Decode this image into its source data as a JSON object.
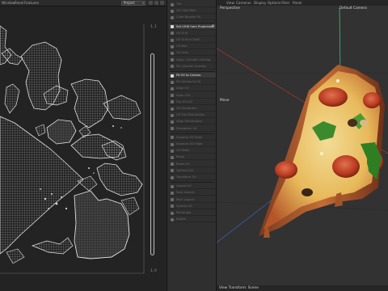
{
  "menubar": {
    "items": [
      "Window",
      "Panel",
      "Features"
    ],
    "project_select": "Project"
  },
  "uv_editor": {
    "corner_top_right": "1, 1",
    "corner_bottom_right": "1, 0"
  },
  "tools": {
    "items": [
      {
        "label": "Tile",
        "active": false
      },
      {
        "label": "UV Cube Box",
        "active": false
      },
      {
        "label": "Cube Bounds Fit",
        "active": false
      },
      {
        "label": "Set UVW from Projection",
        "active": true
      },
      {
        "label": "UV Grid",
        "active": false
      },
      {
        "label": "UV Grid to Shell",
        "active": false
      },
      {
        "label": "UV Box",
        "active": false
      },
      {
        "label": "UV Area",
        "active": false
      },
      {
        "label": "Apply Cylinder Unwrap",
        "active": false
      },
      {
        "label": "Fix Cylinder Unwrap",
        "active": false
      },
      {
        "label": "Fit UV to Canvas",
        "active": true
      },
      {
        "label": "Fit Canvas to UV",
        "active": false
      },
      {
        "label": "Align UV",
        "active": false
      },
      {
        "label": "Align UVs",
        "active": false
      },
      {
        "label": "Flip UV X/Y",
        "active": false
      },
      {
        "label": "UV Straighten",
        "active": false
      },
      {
        "label": "UV Tile Distribution",
        "active": false
      },
      {
        "label": "Align Distribution",
        "active": false
      },
      {
        "label": "Straighten UV",
        "active": false
      },
      {
        "label": "Equalize UV Shell",
        "active": false
      },
      {
        "label": "Equalize UV Edge",
        "active": false
      },
      {
        "label": "UV Relax",
        "active": false
      },
      {
        "label": "Relax",
        "active": false
      },
      {
        "label": "Relax UV",
        "active": false
      },
      {
        "label": "Optimal UV",
        "active": false
      },
      {
        "label": "Transform UV",
        "active": false
      },
      {
        "label": "Layout UV",
        "active": false
      },
      {
        "label": "Pack Islands",
        "active": false
      },
      {
        "label": "Pack Layout",
        "active": false
      },
      {
        "label": "Spread UV",
        "active": false
      },
      {
        "label": "Rectangle",
        "active": false
      },
      {
        "label": "Rotate",
        "active": false
      }
    ]
  },
  "viewport": {
    "menu": [
      "View",
      "Cameras",
      "Display",
      "Options",
      "Filter",
      "Panel"
    ],
    "label_perspective": "Perspective",
    "label_camera": "Default Camera",
    "label_move": "Move",
    "status_bottom": "View Transform: Scene"
  },
  "colors": {
    "uv_bg": "#232323",
    "uv_wire": "#cfcfcf",
    "panel_bg": "#2f2f2f",
    "viewport_bg": "#323232",
    "axis_green": "#3fbf7a",
    "axis_red": "#c0392b",
    "axis_blue": "#3a6fd8"
  }
}
